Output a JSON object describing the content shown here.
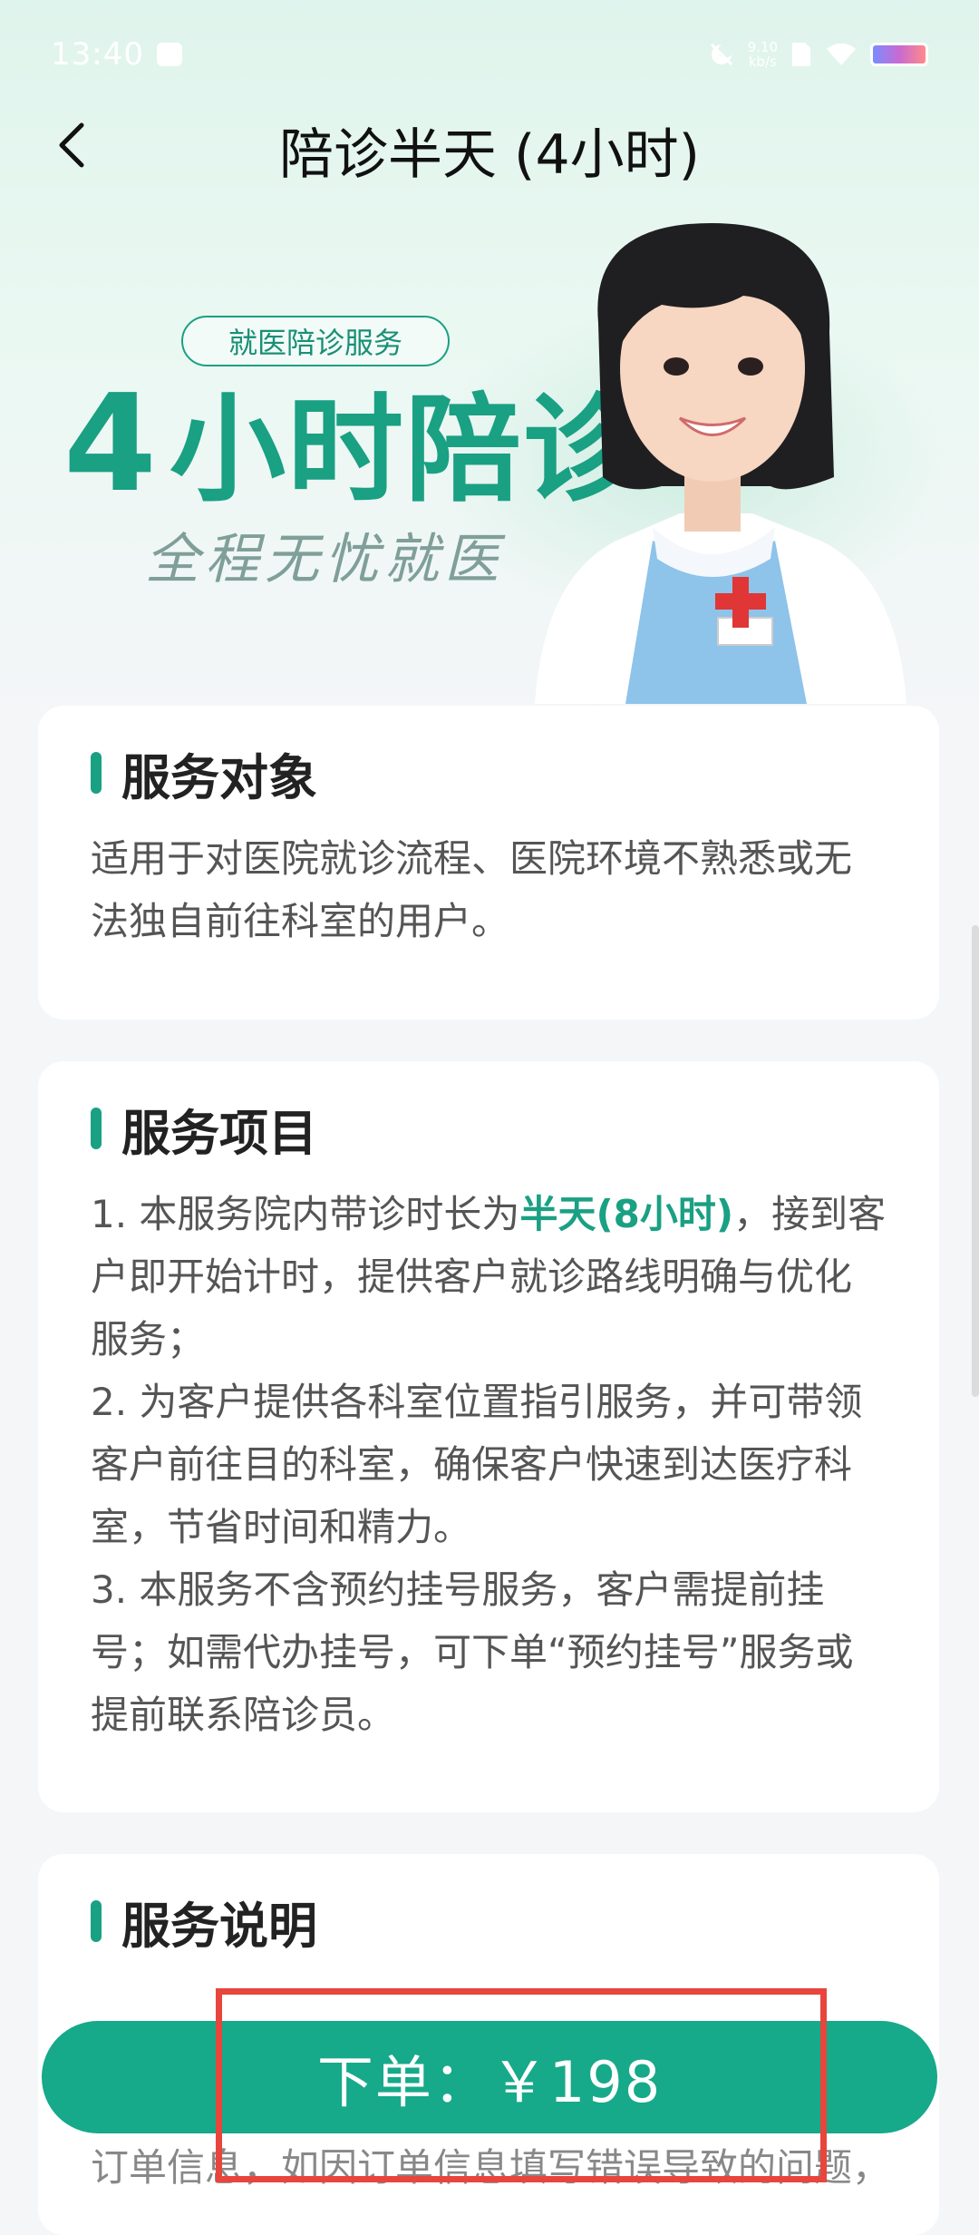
{
  "status_bar": {
    "time": "13:40",
    "net_speed_value": "9.10",
    "net_speed_unit": "kb/s"
  },
  "header": {
    "title": "陪诊半天 (4小时)"
  },
  "banner": {
    "tag": "就医陪诊服务",
    "headline_number": "4",
    "headline_text": "小时陪诊",
    "slogan": "全程无忧就医"
  },
  "sections": {
    "target": {
      "title": "服务对象",
      "body": "适用于对医院就诊流程、医院环境不熟悉或无法独自前往科室的用户。"
    },
    "items": {
      "title": "服务项目",
      "item1_prefix": "1. 本服务院内带诊时长为",
      "item1_highlight": "半天(8小时)",
      "item1_suffix": "，接到客户即开始计时，提供客户就诊路线明确与优化服务；",
      "item2": "2. 为客户提供各科室位置指引服务，并可带领客户前往目的科室，确保客户快速到达医疗科室，节省时间和精力。",
      "item3": "3. 本服务不含预约挂号服务，客户需提前挂号；如需代办挂号，可下单“预约挂号”服务或提前联系陪诊员。"
    },
    "notes": {
      "title": "服务说明",
      "partial_text": "订单信息，如因订单信息填写错误导致的问题，"
    }
  },
  "order": {
    "label": "下单：￥198"
  },
  "colors": {
    "accent": "#1aa083",
    "button": "#16a98a",
    "highlight_box": "#e8453d"
  }
}
